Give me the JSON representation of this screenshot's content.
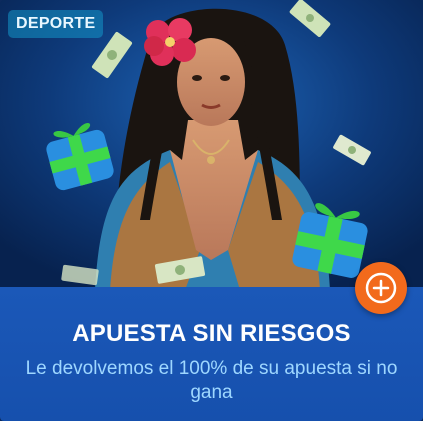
{
  "promo": {
    "category_badge": "DEPORTE",
    "title": "APUESTA SIN RIESGOS",
    "subtitle": "Le devolvemos el 100% de su apuesta si no gana"
  },
  "icons": {
    "expand": "plus-circle-icon",
    "decor": [
      "gift-box-icon",
      "banknote-icon",
      "hibiscus-flower-icon"
    ]
  },
  "colors": {
    "panel": "#1b58b8",
    "title": "#ffffff",
    "subtitle": "#9ed7ff",
    "accent_button": "#f26a1c",
    "badge_bg": "#2aa0c8"
  }
}
